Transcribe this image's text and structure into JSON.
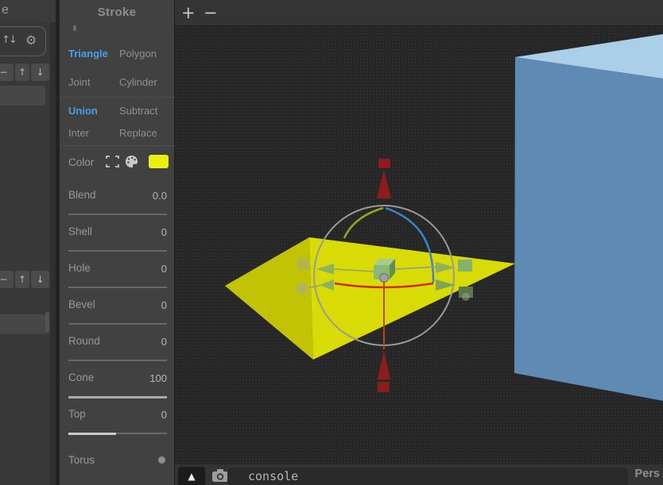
{
  "left_sidebar": {
    "header_fragment": "e",
    "icons": {
      "sort": "↑↓",
      "gear": "⚙",
      "minus": "−",
      "up": "↑",
      "down": "↓"
    }
  },
  "stroke_panel": {
    "title": "Stroke",
    "shapes": [
      {
        "label": "Triangle",
        "active": true
      },
      {
        "label": "Polygon",
        "active": false
      },
      {
        "label": "Joint",
        "active": false
      },
      {
        "label": "Cylinder",
        "active": false
      }
    ],
    "booleans": [
      {
        "label": "Union",
        "active": true
      },
      {
        "label": "Subtract",
        "active": false
      },
      {
        "label": "Inter",
        "active": false
      },
      {
        "label": "Replace",
        "active": false
      }
    ],
    "color": {
      "label": "Color",
      "swatch": "#e9ef10"
    },
    "sliders": [
      {
        "label": "Blend",
        "value": "0.0",
        "fill_pct": 0,
        "fill_color": "#c9c9c9"
      },
      {
        "label": "Shell",
        "value": "0",
        "fill_pct": 0,
        "fill_color": "#c9c9c9"
      },
      {
        "label": "Hole",
        "value": "0",
        "fill_pct": 0,
        "fill_color": "#c9c9c9"
      },
      {
        "label": "Bevel",
        "value": "0",
        "fill_pct": 0,
        "fill_color": "#c9c9c9"
      },
      {
        "label": "Round",
        "value": "0",
        "fill_pct": 0,
        "fill_color": "#c9c9c9"
      },
      {
        "label": "Cone",
        "value": "100",
        "fill_pct": 100,
        "fill_color": "#a9a9a9"
      },
      {
        "label": "Top",
        "value": "0",
        "fill_pct": 48,
        "fill_color": "#cacaca"
      }
    ],
    "torus": {
      "label": "Torus"
    }
  },
  "viewport": {
    "add_button": "+",
    "remove_button": "−",
    "play_icon": "▲",
    "console_placeholder": "console",
    "camera_mode": "Pers"
  },
  "scene": {
    "cone_left_face": "#c3c306",
    "cone_right_face": "#d9db07",
    "box_top_face": "#abcfe9",
    "box_front_face": "#5e8ab3",
    "gizmo_ring": "#9a9a9a",
    "gizmo_axis": "#8d1d1d",
    "gizmo_line": "#b8490f",
    "gizmo_arc_red": "#cf2c00",
    "gizmo_arc_blue": "#3f83c8",
    "gizmo_arc_olive": "#9aa51d",
    "handle_green": "#8fb25c",
    "handle_green_mid": "#7fa35a",
    "handle_green_dark": "#5a7a47",
    "handle_square_green": "#85b16b",
    "cube_top": "#a5cc8f",
    "cube_front": "#8cb873",
    "cube_side": "#628f4e",
    "handle_ghost": "#a7a79a",
    "center_dot": "#9f9f9f"
  }
}
